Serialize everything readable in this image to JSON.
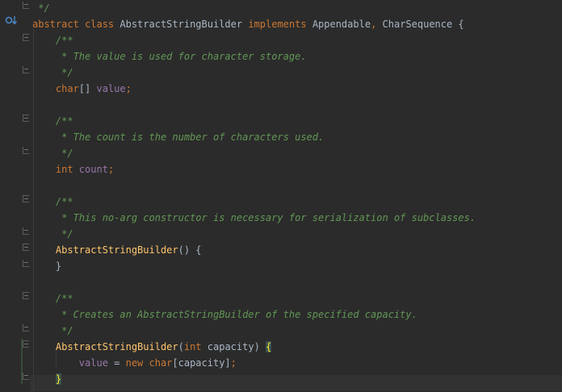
{
  "editor": {
    "lines": [
      {
        "tokens": [
          {
            "t": " */",
            "c": "cm"
          }
        ]
      },
      {
        "tokens": [
          {
            "t": "abstract class ",
            "c": "kw"
          },
          {
            "t": "AbstractStringBuilder ",
            "c": "ty"
          },
          {
            "t": "implements ",
            "c": "kw"
          },
          {
            "t": "Appendable",
            "c": "ty"
          },
          {
            "t": ", ",
            "c": "kw"
          },
          {
            "t": "CharSequence {",
            "c": "ty"
          }
        ]
      },
      {
        "tokens": [
          {
            "t": "    /**",
            "c": "cm"
          }
        ]
      },
      {
        "tokens": [
          {
            "t": "     * The value is used for character storage.",
            "c": "cm"
          }
        ]
      },
      {
        "tokens": [
          {
            "t": "     */",
            "c": "cm"
          }
        ]
      },
      {
        "tokens": [
          {
            "t": "    char",
            "c": "kw"
          },
          {
            "t": "[] ",
            "c": "ty"
          },
          {
            "t": "value",
            "c": "fld"
          },
          {
            "t": ";",
            "c": "kw"
          }
        ]
      },
      {
        "tokens": []
      },
      {
        "tokens": [
          {
            "t": "    /**",
            "c": "cm"
          }
        ]
      },
      {
        "tokens": [
          {
            "t": "     * The count is the number of characters used.",
            "c": "cm"
          }
        ]
      },
      {
        "tokens": [
          {
            "t": "     */",
            "c": "cm"
          }
        ]
      },
      {
        "tokens": [
          {
            "t": "    int ",
            "c": "kw"
          },
          {
            "t": "count",
            "c": "fld"
          },
          {
            "t": ";",
            "c": "kw"
          }
        ]
      },
      {
        "tokens": []
      },
      {
        "tokens": [
          {
            "t": "    /**",
            "c": "cm"
          }
        ]
      },
      {
        "tokens": [
          {
            "t": "     * This no-arg constructor is necessary for serialization of subclasses.",
            "c": "cm"
          }
        ]
      },
      {
        "tokens": [
          {
            "t": "     */",
            "c": "cm"
          }
        ]
      },
      {
        "tokens": [
          {
            "t": "    ",
            "c": "ty"
          },
          {
            "t": "AbstractStringBuilder",
            "c": "fn"
          },
          {
            "t": "() {",
            "c": "ty"
          }
        ]
      },
      {
        "tokens": [
          {
            "t": "    }",
            "c": "ty"
          }
        ]
      },
      {
        "tokens": []
      },
      {
        "tokens": [
          {
            "t": "    /**",
            "c": "cm"
          }
        ]
      },
      {
        "tokens": [
          {
            "t": "     * Creates an AbstractStringBuilder of the specified capacity.",
            "c": "cm"
          }
        ]
      },
      {
        "tokens": [
          {
            "t": "     */",
            "c": "cm"
          }
        ]
      },
      {
        "tokens": [
          {
            "t": "    ",
            "c": "ty"
          },
          {
            "t": "AbstractStringBuilder",
            "c": "fn"
          },
          {
            "t": "(",
            "c": "ty"
          },
          {
            "t": "int ",
            "c": "kw"
          },
          {
            "t": "capacity) ",
            "c": "ty"
          },
          {
            "t": "{",
            "c": "brace-hl"
          }
        ]
      },
      {
        "tokens": [
          {
            "t": "        ",
            "c": "ty"
          },
          {
            "t": "value ",
            "c": "fld"
          },
          {
            "t": "= ",
            "c": "ty"
          },
          {
            "t": "new char",
            "c": "kw"
          },
          {
            "t": "[capacity]",
            "c": "ty"
          },
          {
            "t": ";",
            "c": "kw"
          }
        ]
      },
      {
        "tokens": [
          {
            "t": "    ",
            "c": "ty"
          },
          {
            "t": "}",
            "c": "brace-hl"
          }
        ]
      }
    ],
    "caret_line": 23,
    "fold_markers": [
      {
        "line": 0,
        "kind": "end"
      },
      {
        "line": 2,
        "kind": "start"
      },
      {
        "line": 4,
        "kind": "end"
      },
      {
        "line": 7,
        "kind": "start"
      },
      {
        "line": 9,
        "kind": "end"
      },
      {
        "line": 12,
        "kind": "start"
      },
      {
        "line": 14,
        "kind": "end"
      },
      {
        "line": 15,
        "kind": "start"
      },
      {
        "line": 16,
        "kind": "end"
      },
      {
        "line": 18,
        "kind": "start"
      },
      {
        "line": 20,
        "kind": "end"
      },
      {
        "line": 21,
        "kind": "start"
      },
      {
        "line": 23,
        "kind": "end"
      }
    ],
    "override_icon": "overridden-method-icon",
    "colors": {
      "background": "#2b2b2b",
      "keyword": "#cc7832",
      "comment": "#629755",
      "field": "#9876aa",
      "method": "#ffc66d",
      "text": "#a9b7c6",
      "caret_row": "#323232"
    }
  }
}
